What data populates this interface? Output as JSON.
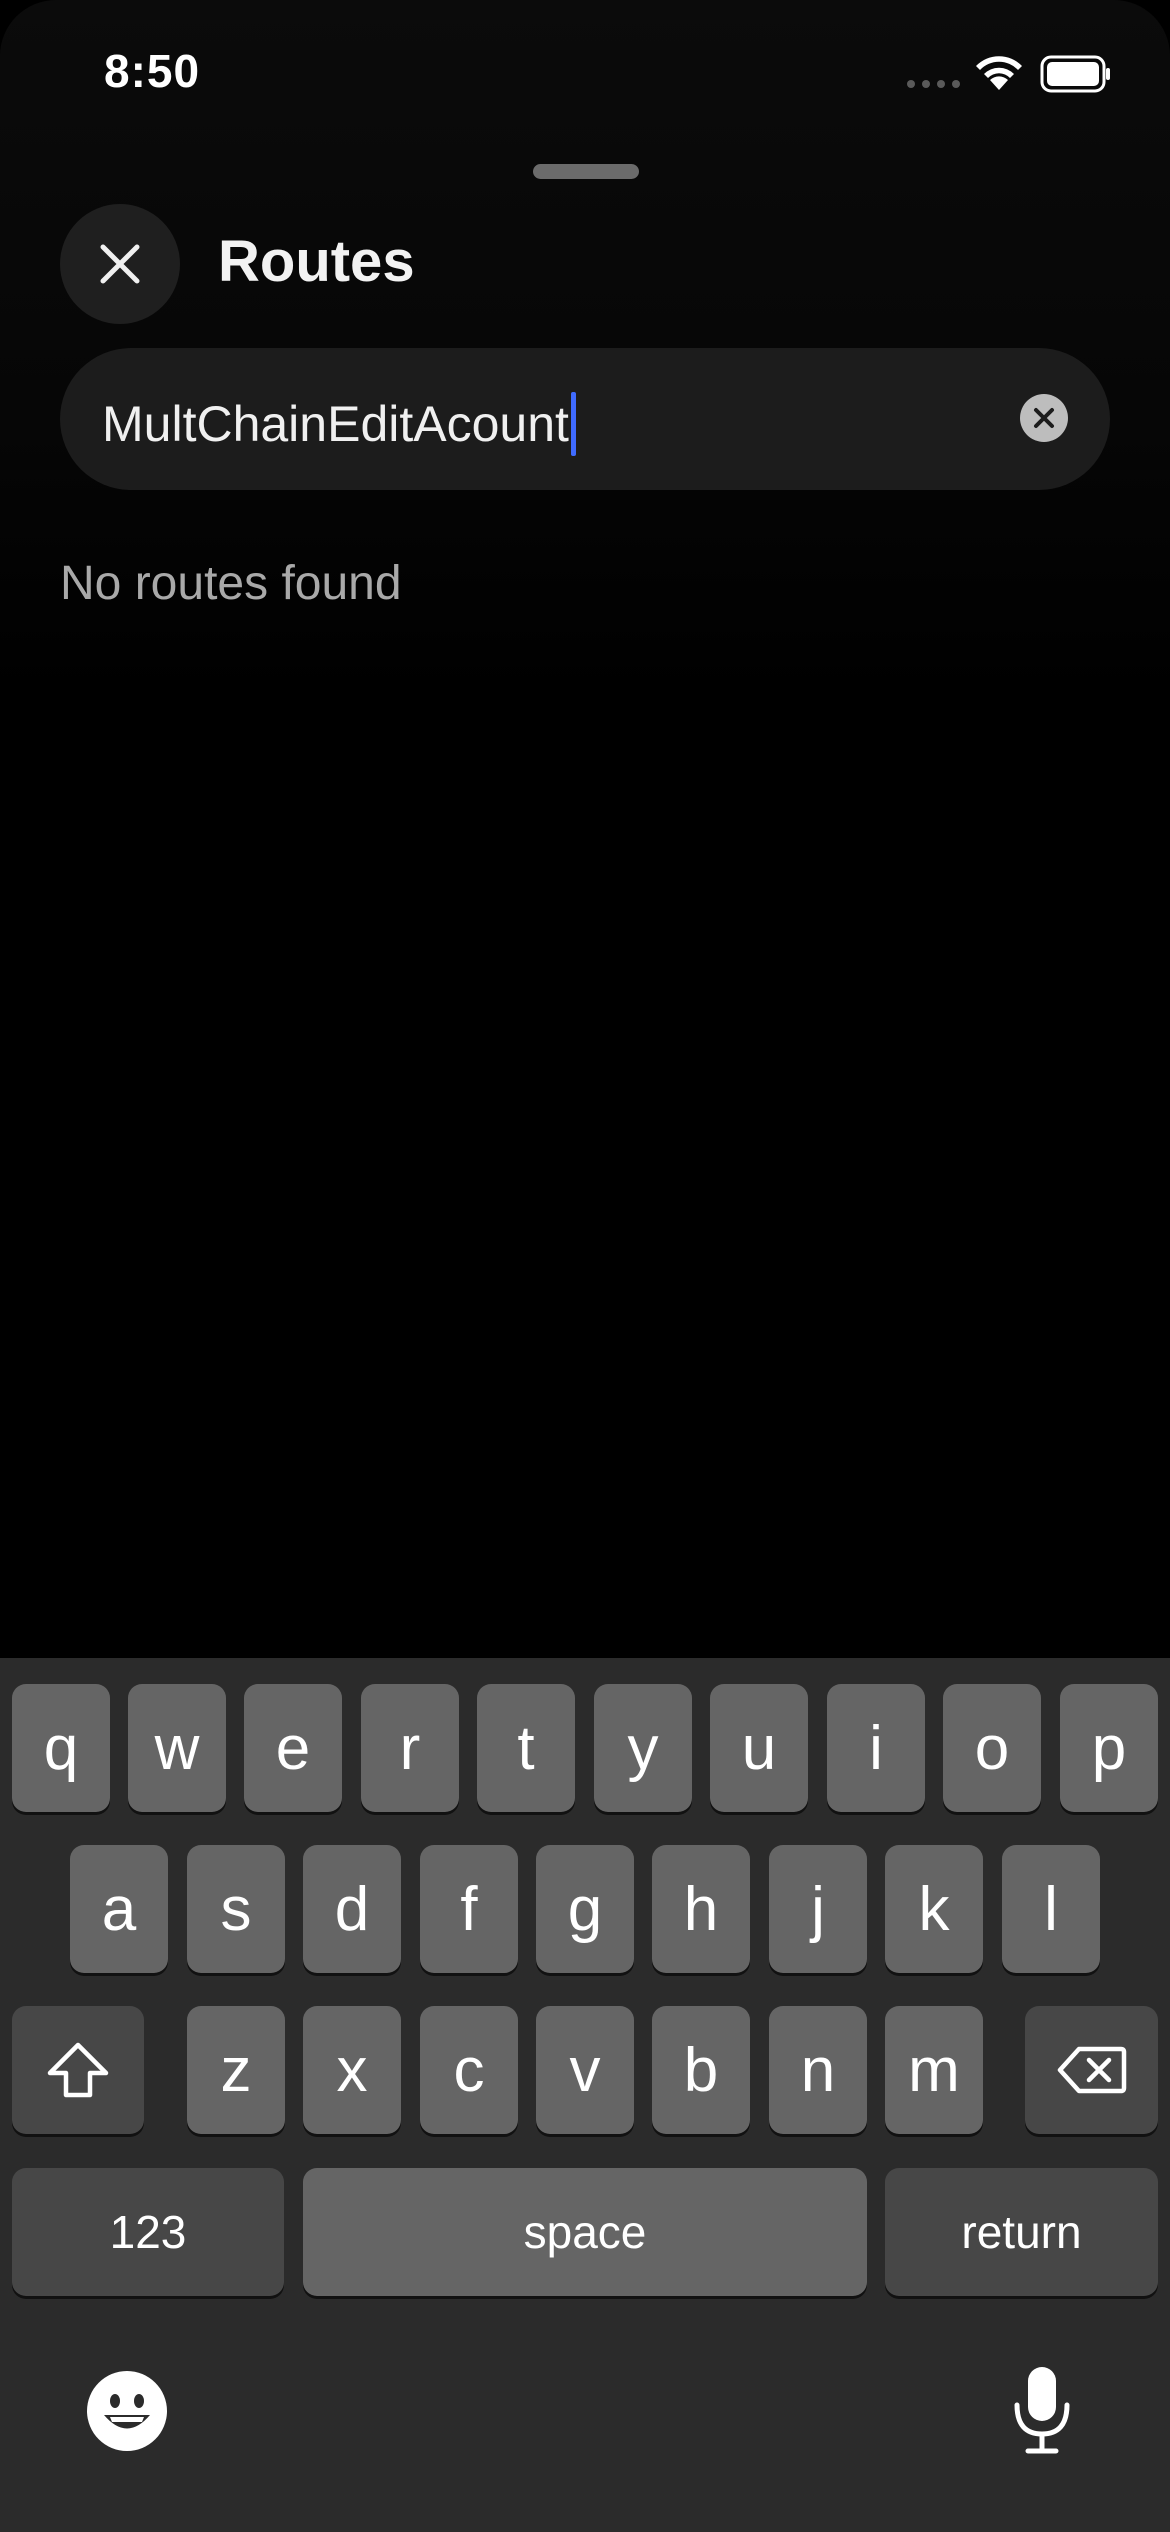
{
  "status_bar": {
    "time": "8:50"
  },
  "header": {
    "title": "Routes"
  },
  "search": {
    "value": "MultChainEditAcount"
  },
  "results": {
    "empty_message": "No routes found"
  },
  "keyboard": {
    "row1": [
      "q",
      "w",
      "e",
      "r",
      "t",
      "y",
      "u",
      "i",
      "o",
      "p"
    ],
    "row2": [
      "a",
      "s",
      "d",
      "f",
      "g",
      "h",
      "j",
      "k",
      "l"
    ],
    "row3": [
      "z",
      "x",
      "c",
      "v",
      "b",
      "n",
      "m"
    ],
    "numbers_label": "123",
    "space_label": "space",
    "return_label": "return"
  },
  "icons": {
    "close": "close-icon",
    "clear": "clear-icon",
    "shift": "shift-icon",
    "backspace": "backspace-icon",
    "emoji": "emoji-icon",
    "microphone": "microphone-icon"
  },
  "colors": {
    "caret": "#3f6bff",
    "background": "#000000",
    "keyboard": "#2b2b2b"
  }
}
